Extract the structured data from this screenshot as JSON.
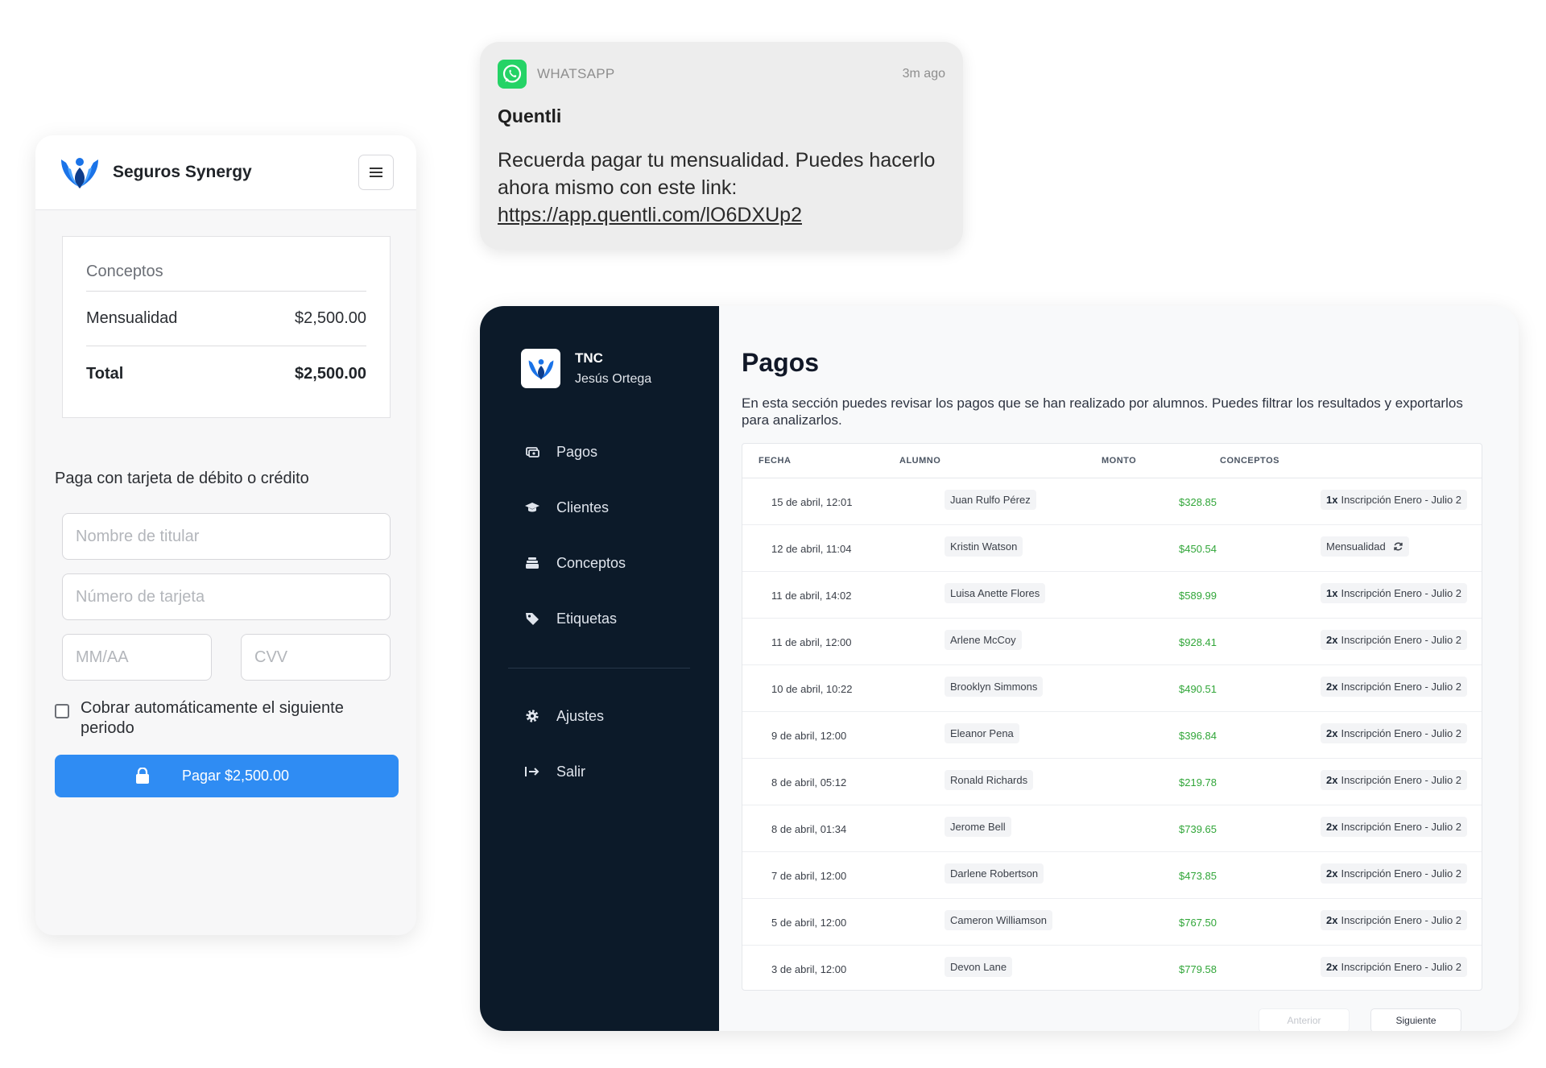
{
  "checkout": {
    "brand_name": "Seguros Synergy",
    "concepts_title": "Conceptos",
    "items": [
      {
        "label": "Mensualidad",
        "amount": "$2,500.00"
      }
    ],
    "total_label": "Total",
    "total_amount": "$2,500.00",
    "pay_title": "Paga con tarjeta de débito o crédito",
    "fields": {
      "holder_placeholder": "Nombre de titular",
      "card_placeholder": "Número de tarjeta",
      "expiry_placeholder": "MM/AA",
      "cvv_placeholder": "CVV"
    },
    "auto_charge_label": "Cobrar automáticamente el siguiente periodo",
    "auto_charge_checked": false,
    "pay_button_label": "Pagar $2,500.00",
    "colors": {
      "primary": "#2f8cf3",
      "logo_blue": "#1a73e8"
    }
  },
  "notification": {
    "app": "WHATSAPP",
    "time": "3m ago",
    "sender": "Quentli",
    "message": "Recuerda pagar tu mensualidad. Puedes hacerlo ahora mismo con este link:",
    "link": "https://app.quentli.com/lO6DXUp2",
    "icon": "whatsapp-icon",
    "colors": {
      "whatsapp_green": "#25d366"
    }
  },
  "dashboard": {
    "org_name": "TNC",
    "user_name": "Jesús Ortega",
    "nav": [
      {
        "label": "Pagos",
        "icon": "payments-icon"
      },
      {
        "label": "Clientes",
        "icon": "graduation-cap-icon"
      },
      {
        "label": "Conceptos",
        "icon": "stack-icon"
      },
      {
        "label": "Etiquetas",
        "icon": "tag-icon"
      }
    ],
    "nav_bottom": [
      {
        "label": "Ajustes",
        "icon": "gear-icon"
      },
      {
        "label": "Salir",
        "icon": "logout-icon"
      }
    ],
    "page_title": "Pagos",
    "page_description": "En esta sección puedes revisar los pagos que se han realizado por alumnos. Puedes filtrar los resultados y exportarlos para analizarlos.",
    "columns": [
      "FECHA",
      "ALUMNO",
      "MONTO",
      "CONCEPTOS"
    ],
    "rows": [
      {
        "date": "15 de abril, 12:01",
        "student": "Juan Rulfo Pérez",
        "amount": "$328.85",
        "qty": "1x",
        "concept": "Inscripción Enero - Julio 2"
      },
      {
        "date": "12 de abril, 11:04",
        "student": "Kristin Watson",
        "amount": "$450.54",
        "qty": "",
        "concept": "Mensualidad"
      },
      {
        "date": "11 de abril, 14:02",
        "student": "Luisa Anette Flores",
        "amount": "$589.99",
        "qty": "1x",
        "concept": "Inscripción Enero - Julio 2"
      },
      {
        "date": "11 de abril, 12:00",
        "student": "Arlene McCoy",
        "amount": "$928.41",
        "qty": "2x",
        "concept": "Inscripción Enero - Julio 2"
      },
      {
        "date": "10 de abril, 10:22",
        "student": "Brooklyn Simmons",
        "amount": "$490.51",
        "qty": "2x",
        "concept": "Inscripción Enero - Julio 2"
      },
      {
        "date": "9 de abril, 12:00",
        "student": "Eleanor Pena",
        "amount": "$396.84",
        "qty": "2x",
        "concept": "Inscripción Enero - Julio 2"
      },
      {
        "date": "8 de abril, 05:12",
        "student": "Ronald Richards",
        "amount": "$219.78",
        "qty": "2x",
        "concept": "Inscripción Enero - Julio 2"
      },
      {
        "date": "8 de abril, 01:34",
        "student": "Jerome Bell",
        "amount": "$739.65",
        "qty": "2x",
        "concept": "Inscripción Enero - Julio 2"
      },
      {
        "date": "7 de abril, 12:00",
        "student": "Darlene Robertson",
        "amount": "$473.85",
        "qty": "2x",
        "concept": "Inscripción Enero - Julio 2"
      },
      {
        "date": "5 de abril, 12:00",
        "student": "Cameron Williamson",
        "amount": "$767.50",
        "qty": "2x",
        "concept": "Inscripción Enero - Julio 2"
      },
      {
        "date": "3 de abril, 12:00",
        "student": "Devon Lane",
        "amount": "$779.58",
        "qty": "2x",
        "concept": "Inscripción Enero - Julio 2"
      }
    ],
    "pagination": {
      "prev": "Anterior",
      "next": "Siguiente"
    },
    "colors": {
      "sidebar": "#0c1a29",
      "amount_green": "#31a639"
    }
  }
}
